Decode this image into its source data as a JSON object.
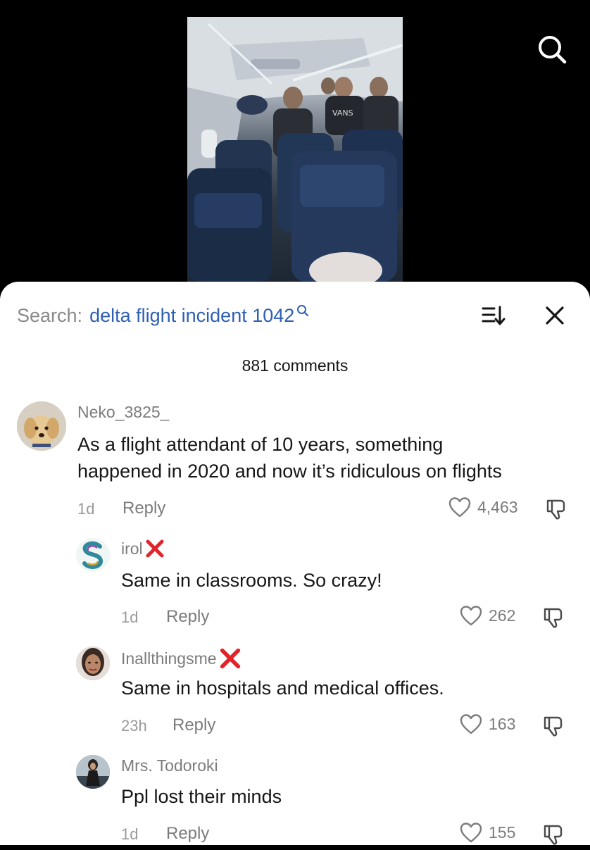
{
  "search": {
    "label": "Search:",
    "query": "delta flight incident 1042"
  },
  "comments_header": {
    "count_text": "881 comments"
  },
  "comments": [
    {
      "username": "Neko_3825_",
      "text_line1": "As a flight attendant of 10 years, something",
      "text_line2": "happened in 2020 and now it’s ridiculous on flights",
      "time": "1d",
      "reply_label": "Reply",
      "likes": "4,463",
      "avatar": "puppy-avatar"
    },
    {
      "username": "irol",
      "badge": "red-x-icon",
      "text": "Same in classrooms. So crazy!",
      "time": "1d",
      "reply_label": "Reply",
      "likes": "262",
      "avatar": "swirl-s-avatar"
    },
    {
      "username": "Inallthingsme",
      "badge": "red-x-icon",
      "text": "Same in hospitals and medical offices.",
      "time": "23h",
      "reply_label": "Reply",
      "likes": "163",
      "avatar": "portrait-avatar"
    },
    {
      "username": "Mrs. Todoroki",
      "text": "Ppl lost their minds",
      "time": "1d",
      "reply_label": "Reply",
      "likes": "155",
      "avatar": "figure-avatar"
    }
  ],
  "colors": {
    "query_blue": "#2f5fb3",
    "badge_red": "#e0242a",
    "muted_text": "#7c7c7c"
  }
}
